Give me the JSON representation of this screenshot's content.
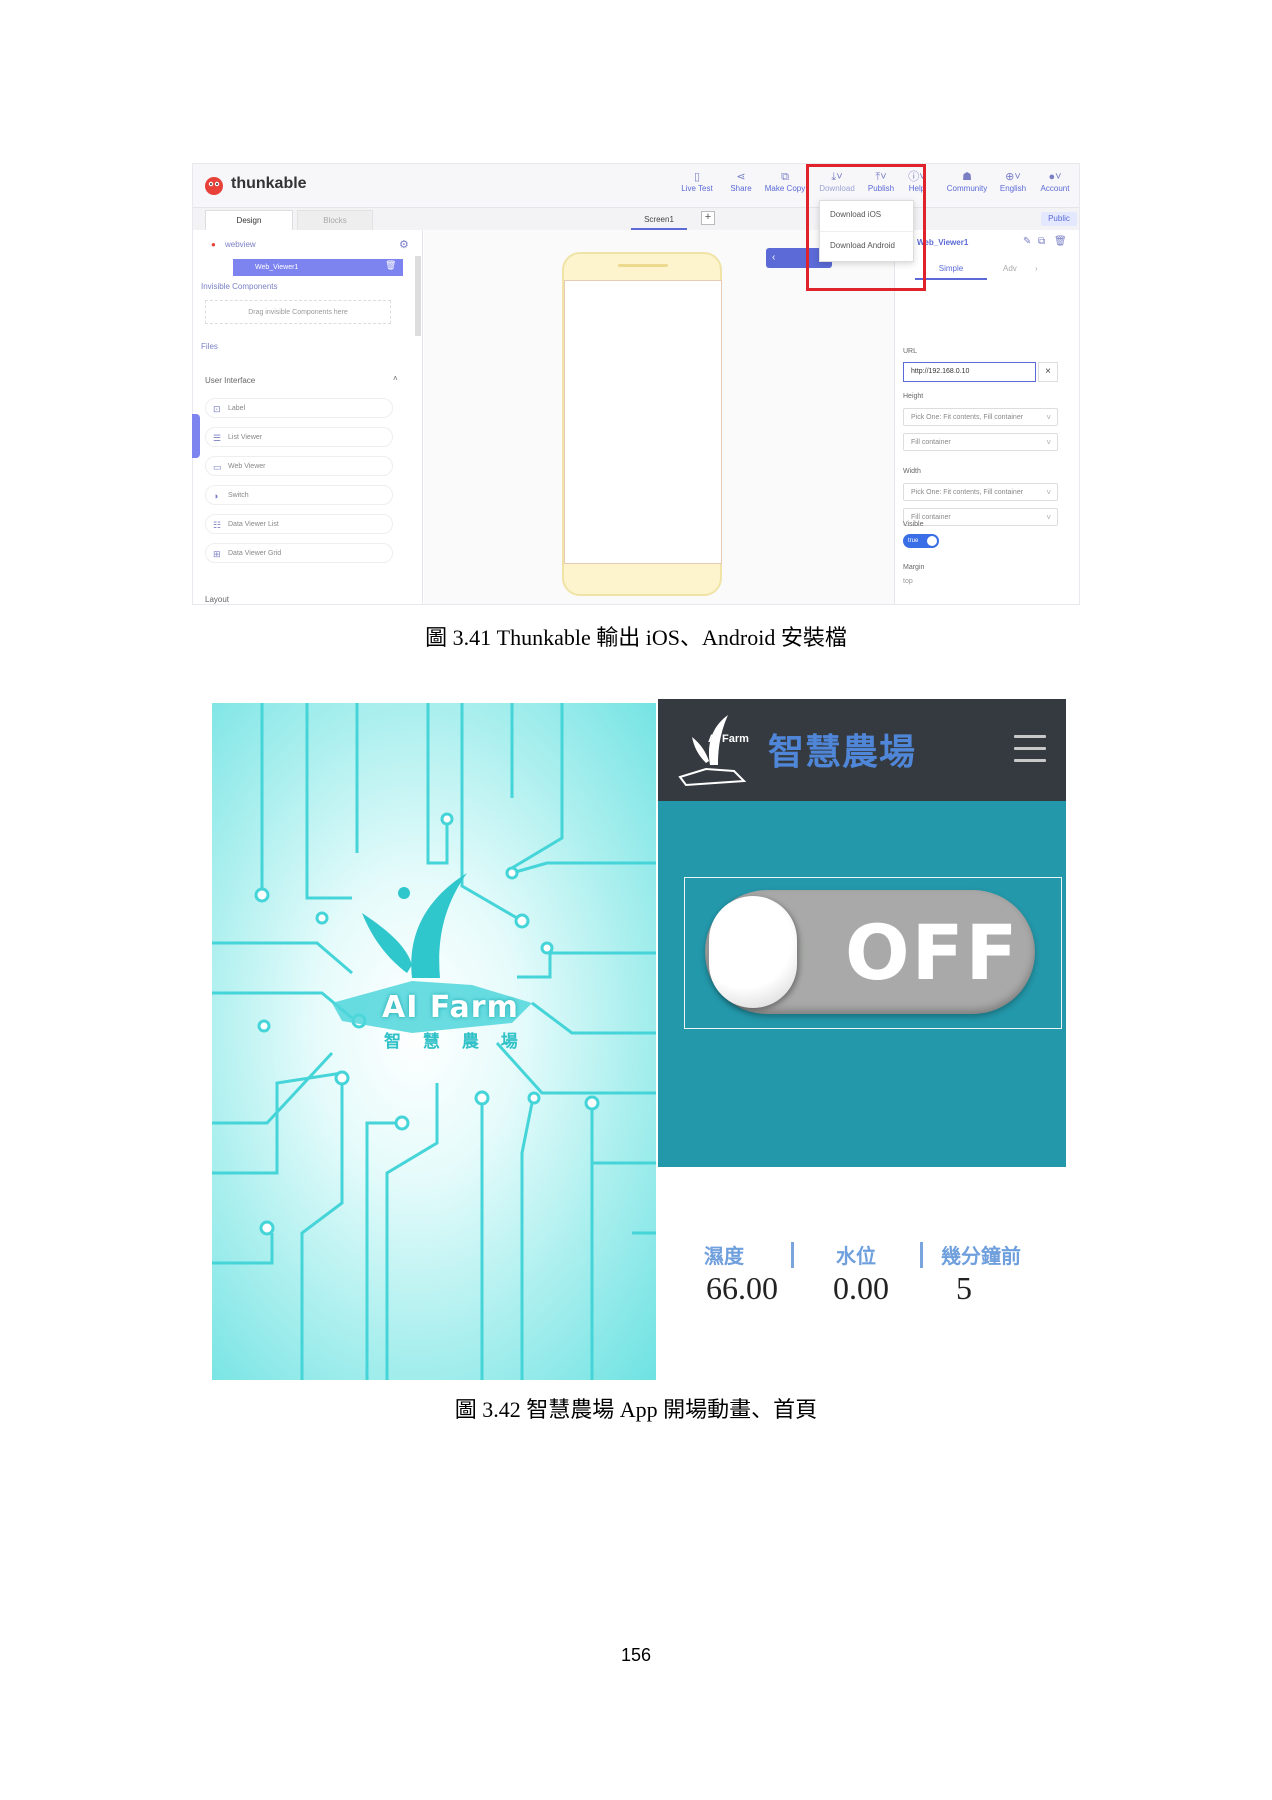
{
  "figure1": {
    "brand": "thunkable",
    "toolbar": [
      {
        "label": "Live Test",
        "icon": "phone-icon"
      },
      {
        "label": "Share",
        "icon": "share-icon"
      },
      {
        "label": "Make Copy",
        "icon": "copy-icon"
      },
      {
        "label": "Download",
        "icon": "download-icon"
      },
      {
        "label": "Publish",
        "icon": "publish-icon"
      },
      {
        "label": "Help",
        "icon": "help-icon"
      },
      {
        "label": "Community",
        "icon": "community-icon"
      },
      {
        "label": "English",
        "icon": "globe-icon"
      },
      {
        "label": "Account",
        "icon": "account-icon"
      }
    ],
    "download_menu": [
      "Download iOS",
      "Download Android"
    ],
    "tabs": {
      "design": "Design",
      "blocks": "Blocks",
      "screen": "Screen1",
      "public": "Public"
    },
    "tree": {
      "root": "webview",
      "selected": "Web_Viewer1",
      "invisible_header": "Invisible Components",
      "drop_hint": "Drag invisible Components here",
      "files_header": "Files",
      "ui_header": "User Interface",
      "layout_header": "Layout"
    },
    "palette": [
      "Label",
      "List Viewer",
      "Web Viewer",
      "Switch",
      "Data Viewer List",
      "Data Viewer Grid"
    ],
    "props": {
      "component": "Web_Viewer1",
      "tab_simple": "Simple",
      "tab_adv": "Adv",
      "url_label": "URL",
      "url_value": "http://192.168.0.10",
      "height_label": "Height",
      "height_pick": "Pick One: Fit contents, Fill container",
      "height_value": "Fill container",
      "width_label": "Width",
      "width_pick": "Pick One: Fit contents, Fill container",
      "width_value": "Fill container",
      "visible_label": "Visible",
      "visible_value": "true",
      "margin_label": "Margin",
      "margin_top": "top"
    },
    "caption": "圖 3.41 Thunkable  輸出 iOS、Android 安裝檔"
  },
  "figure2": {
    "splash": {
      "logo_text": "AI Farm",
      "logo_sub": "智 慧 農 場"
    },
    "app": {
      "logo_text": "AI Farm",
      "title": "智慧農場",
      "switch_state": "OFF",
      "stats": [
        {
          "label": "濕度",
          "value": "66.00"
        },
        {
          "label": "水位",
          "value": "0.00"
        },
        {
          "label": "幾分鐘前",
          "value": "5"
        }
      ],
      "colors": {
        "header": "#343a40",
        "switch_bg": "#2398aa",
        "title": "#4f86d8"
      }
    },
    "caption": "圖 3.42 智慧農場 App 開場動畫、首頁"
  },
  "page_number": "156"
}
